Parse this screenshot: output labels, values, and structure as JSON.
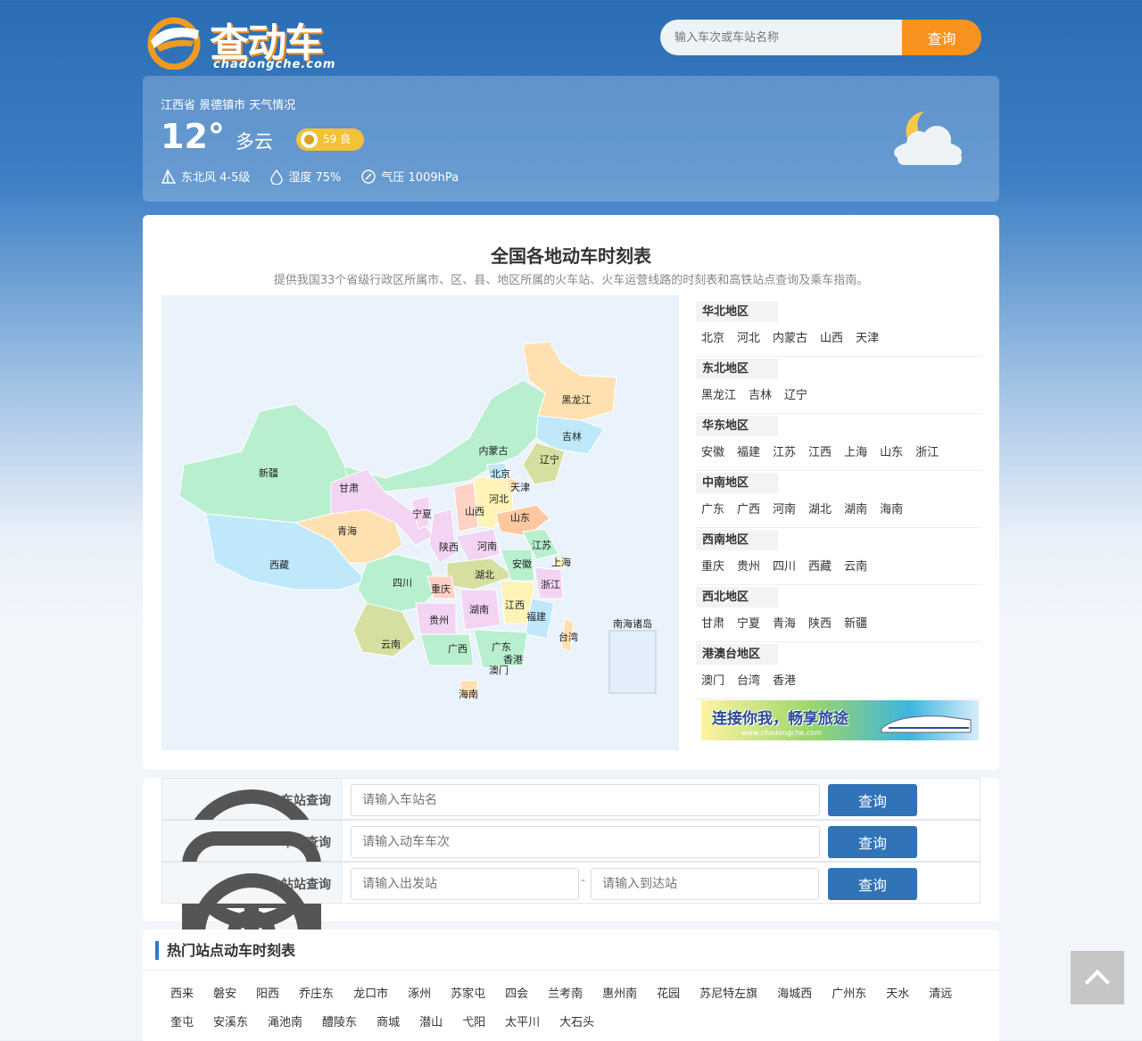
{
  "header": {
    "logo_cn": "查动车",
    "logo_en": "chadongche.com",
    "search_placeholder": "输入车次或车站名称",
    "search_button": "查询"
  },
  "weather": {
    "location": "江西省 景德镇市 天气情况",
    "temperature": "12°",
    "condition": "多云",
    "aqi": "59 良",
    "wind": "东北风 4-5级",
    "humidity": "湿度 75%",
    "pressure": "气压 1009hPa"
  },
  "map_section": {
    "title": "全国各地动车时刻表",
    "subtitle": "提供我国33个省级行政区所属市、区、县、地区所属的火车站、火车运营线路的时刻表和高铁站点查询及乘车指南。",
    "provinces": [
      "黑龙江",
      "吉林",
      "内蒙古",
      "辽宁",
      "北京",
      "天津",
      "新疆",
      "甘肃",
      "河北",
      "宁夏",
      "山西",
      "山东",
      "青海",
      "陕西",
      "河南",
      "江苏",
      "西藏",
      "湖北",
      "安徽",
      "上海",
      "四川",
      "重庆",
      "浙江",
      "湖南",
      "江西",
      "贵州",
      "福建",
      "台湾",
      "南海诸岛",
      "云南",
      "广西",
      "广东",
      "香港",
      "澳门",
      "海南"
    ],
    "regions": [
      {
        "name": "华北地区",
        "items": [
          "北京",
          "河北",
          "内蒙古",
          "山西",
          "天津"
        ]
      },
      {
        "name": "东北地区",
        "items": [
          "黑龙江",
          "吉林",
          "辽宁"
        ]
      },
      {
        "name": "华东地区",
        "items": [
          "安徽",
          "福建",
          "江苏",
          "江西",
          "上海",
          "山东",
          "浙江"
        ]
      },
      {
        "name": "中南地区",
        "items": [
          "广东",
          "广西",
          "河南",
          "湖北",
          "湖南",
          "海南"
        ]
      },
      {
        "name": "西南地区",
        "items": [
          "重庆",
          "贵州",
          "四川",
          "西藏",
          "云南"
        ]
      },
      {
        "name": "西北地区",
        "items": [
          "甘肃",
          "宁夏",
          "青海",
          "陕西",
          "新疆"
        ]
      },
      {
        "name": "港澳台地区",
        "items": [
          "澳门",
          "台湾",
          "香港"
        ]
      }
    ],
    "banner_text": "连接你我，畅享旅途",
    "banner_url": "www.chadongche.com"
  },
  "query": {
    "station": {
      "label": "车站查询",
      "placeholder": "请输入车站名",
      "button": "查询"
    },
    "train": {
      "label": "车次查询",
      "placeholder": "请输入动车车次",
      "button": "查询"
    },
    "route": {
      "label": "站站查询",
      "from_placeholder": "请输入出发站",
      "to_placeholder": "请输入到达站",
      "separator": "-",
      "button": "查询"
    }
  },
  "hot": {
    "title": "热门站点动车时刻表",
    "stations": [
      "西来",
      "磐安",
      "阳西",
      "乔庄东",
      "龙口市",
      "涿州",
      "苏家屯",
      "四会",
      "兰考南",
      "惠州南",
      "花园",
      "苏尼特左旗",
      "海城西",
      "广州东",
      "天水",
      "清远",
      "奎屯",
      "安溪东",
      "渑池南",
      "醴陵东",
      "商城",
      "潜山",
      "弋阳",
      "太平川",
      "大石头"
    ]
  },
  "colors": {
    "accent": "#f7921e",
    "primary": "#3073b6"
  }
}
